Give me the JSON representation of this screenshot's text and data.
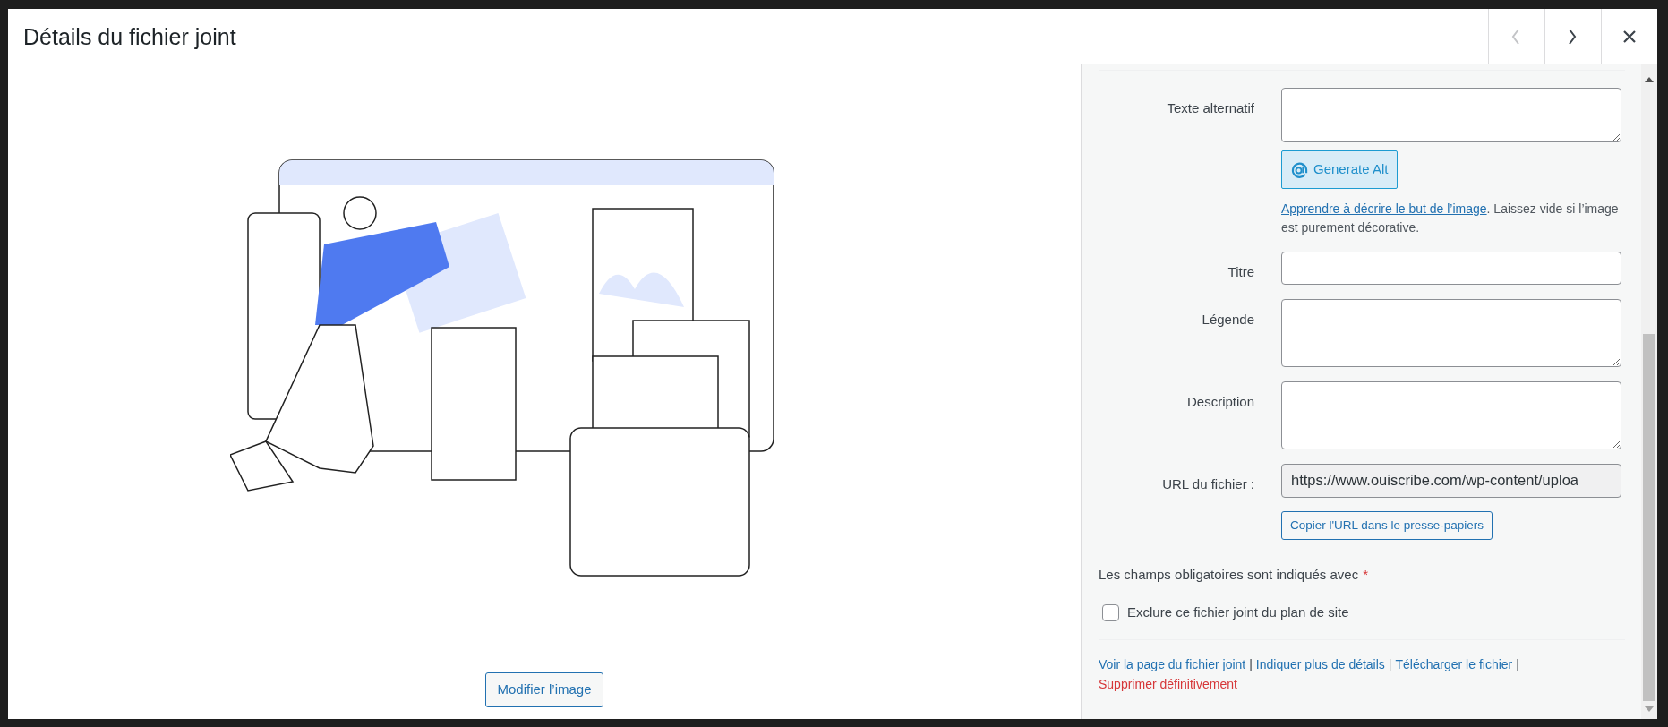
{
  "dialog": {
    "title": "Détails du fichier joint",
    "nav_buttons": [
      {
        "kind": "prev",
        "disabled": true
      },
      {
        "kind": "next",
        "disabled": false
      },
      {
        "kind": "close",
        "disabled": false
      }
    ]
  },
  "preview": {
    "kind": "picture",
    "edit_button": "Modifier l’image"
  },
  "fields": [
    {
      "label": "Texte alternatif",
      "kind": "textarea",
      "ai_button": "Generate Alt",
      "help": {
        "link": "Apprendre à décrire le but de l’image",
        "text": ". Laissez vide si l’image est purement décorative."
      }
    },
    {
      "label": "Titre",
      "kind": "input"
    },
    {
      "label": "Légende",
      "kind": "textarea"
    },
    {
      "label": "Description",
      "kind": "textarea"
    },
    {
      "label": "URL du fichier :",
      "kind": "readonly",
      "value": "https://www.ouiscribe.com/wp-content/uploa",
      "copy_button": "Copier l'URL dans le presse-papiers"
    }
  ],
  "required_note": {
    "text": "Les champs obligatoires sont indiqués avec",
    "mark": "*"
  },
  "sitemap_option": {
    "label": "Exclure ce fichier joint du plan de site",
    "checked": false
  },
  "actions": [
    {
      "kind": "link",
      "label": "Voir la page du fichier joint"
    },
    {
      "kind": "separator",
      "label": "|"
    },
    {
      "kind": "link",
      "label": "Indiquer plus de détails"
    },
    {
      "kind": "separator",
      "label": "|"
    },
    {
      "kind": "link",
      "label": "Télécharger le fichier"
    },
    {
      "kind": "separator",
      "label": "|"
    },
    {
      "kind": "danger",
      "label": "Supprimer définitivement"
    }
  ]
}
